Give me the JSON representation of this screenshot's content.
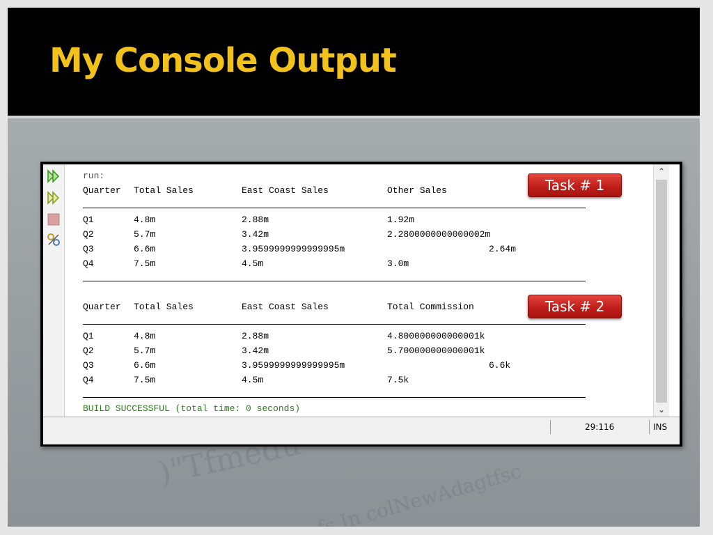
{
  "slide": {
    "title": "My Console Output"
  },
  "console": {
    "run_label": "run:",
    "task1": {
      "badge": "Task # 1",
      "headers": [
        "Quarter",
        "Total Sales",
        "East Coast Sales",
        "Other Sales"
      ],
      "rows": [
        [
          "Q1",
          "4.8m",
          "2.88m",
          "1.92m"
        ],
        [
          "Q2",
          "5.7m",
          "3.42m",
          "2.2800000000000002m"
        ],
        [
          "Q3",
          "6.6m",
          "3.9599999999999995m",
          "2.64m"
        ],
        [
          "Q4",
          "7.5m",
          "4.5m",
          "3.0m"
        ]
      ]
    },
    "task2": {
      "badge": "Task # 2",
      "headers": [
        "Quarter",
        "Total Sales",
        "East Coast Sales",
        "Total Commission"
      ],
      "rows": [
        [
          "Q1",
          "4.8m",
          "2.88m",
          "4.800000000000001k"
        ],
        [
          "Q2",
          "5.7m",
          "3.42m",
          "5.700000000000001k"
        ],
        [
          "Q3",
          "6.6m",
          "3.9599999999999995m",
          "6.6k"
        ],
        [
          "Q4",
          "7.5m",
          "4.5m",
          "7.5k"
        ]
      ]
    },
    "build_message": "BUILD SUCCESSFUL (total time: 0 seconds)"
  },
  "toolbar": {
    "icons": [
      "rerun-icon",
      "rerun-with-options-icon",
      "stop-icon",
      "settings-icon"
    ],
    "colors": {
      "run_green": "#3a9c1e",
      "stop_red": "#c97b7b"
    }
  },
  "statusbar": {
    "position": "29:116",
    "mode": "INS"
  },
  "colors": {
    "title": "#f2c11c",
    "badge": "#c01e1a",
    "build_success": "#2e7d1e"
  }
}
